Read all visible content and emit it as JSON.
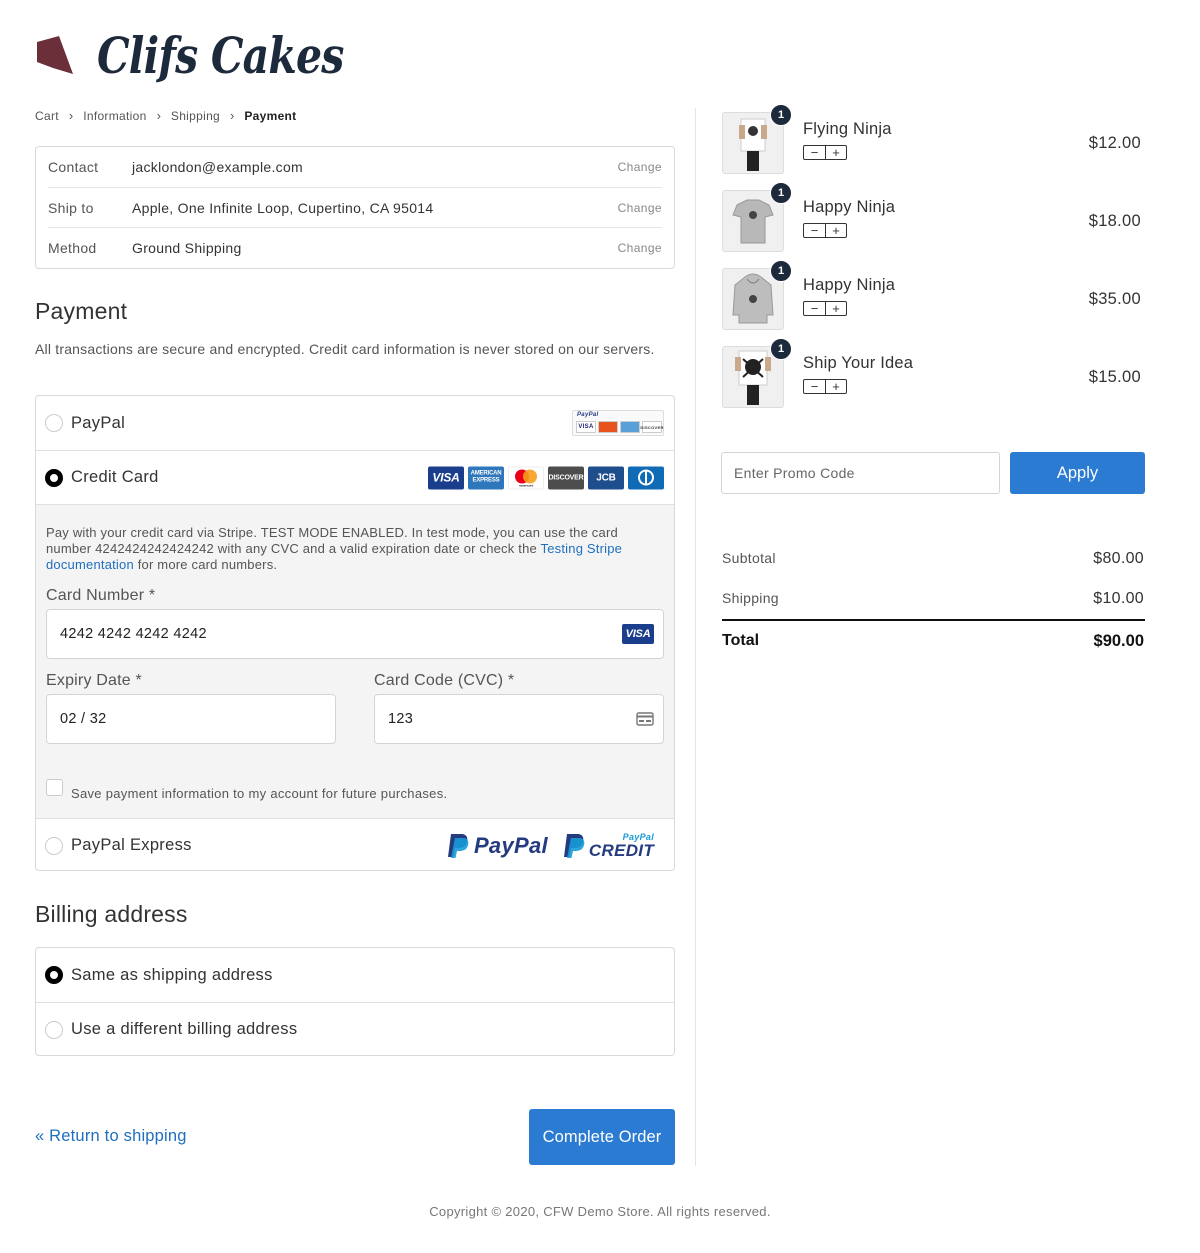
{
  "store": {
    "name": "Clifs Cakes",
    "logo_color": "#6b2f3a"
  },
  "breadcrumb": [
    {
      "label": "Cart",
      "current": false
    },
    {
      "label": "Information",
      "current": false
    },
    {
      "label": "Shipping",
      "current": false
    },
    {
      "label": "Payment",
      "current": true
    }
  ],
  "review": {
    "contact": {
      "label": "Contact",
      "value": "jacklondon@example.com",
      "change": "Change"
    },
    "ship_to": {
      "label": "Ship to",
      "value": "Apple, One Infinite Loop, Cupertino, CA 95014",
      "change": "Change"
    },
    "method": {
      "label": "Method",
      "value": "Ground Shipping",
      "change": "Change"
    }
  },
  "payment": {
    "heading": "Payment",
    "description": "All transactions are secure and encrypted. Credit card information is never stored on our servers.",
    "options": {
      "paypal": {
        "label": "PayPal",
        "selected": false
      },
      "credit_card": {
        "label": "Credit Card",
        "selected": true
      },
      "paypal_express": {
        "label": "PayPal Express",
        "selected": false
      }
    },
    "card_brands": [
      "VISA",
      "AMERICAN EXPRESS",
      "mastercard",
      "DISCOVER",
      "JCB",
      "Diners Club"
    ],
    "paypal_mini": {
      "top": "PayPal",
      "brands": [
        "VISA",
        "",
        "",
        "DISCOVER"
      ]
    },
    "paypal_express_logos": {
      "paypal": "PayPal",
      "credit_small": "PayPal",
      "credit": "CREDIT"
    },
    "stripe_info": {
      "text_before": "Pay with your credit card via Stripe. TEST MODE ENABLED. In test mode, you can use the card number 4242424242424242 with any CVC and a valid expiration date or check the ",
      "link": "Testing Stripe documentation",
      "text_after": " for more card numbers."
    },
    "card_number": {
      "label": "Card Number *",
      "value": "4242 4242 4242 4242",
      "brand": "VISA"
    },
    "expiry": {
      "label": "Expiry Date *",
      "value": "02 / 32"
    },
    "cvc": {
      "label": "Card Code (CVC) *",
      "value": "123"
    },
    "save_info": {
      "label": "Save payment information to my account for future purchases.",
      "checked": false
    }
  },
  "billing": {
    "heading": "Billing address",
    "same": {
      "label": "Same as shipping address",
      "selected": true
    },
    "different": {
      "label": "Use a different billing address",
      "selected": false
    }
  },
  "actions": {
    "return": "« Return to shipping",
    "complete": "Complete Order"
  },
  "cart": {
    "items": [
      {
        "name": "Flying Ninja",
        "qty": "1",
        "price": "$12.00",
        "thumb": "poster-icon"
      },
      {
        "name": "Happy Ninja",
        "qty": "1",
        "price": "$18.00",
        "thumb": "tshirt-icon"
      },
      {
        "name": "Happy Ninja",
        "qty": "1",
        "price": "$35.00",
        "thumb": "hoodie-icon"
      },
      {
        "name": "Ship Your Idea",
        "qty": "1",
        "price": "$15.00",
        "thumb": "poster-icon"
      }
    ],
    "stepper": {
      "minus": "−",
      "plus": "+"
    }
  },
  "promo": {
    "placeholder": "Enter Promo Code",
    "button": "Apply"
  },
  "totals": {
    "subtotal": {
      "label": "Subtotal",
      "value": "$80.00"
    },
    "shipping": {
      "label": "Shipping",
      "value": "$10.00"
    },
    "total": {
      "label": "Total",
      "value": "$90.00"
    }
  },
  "footer": "Copyright © 2020, CFW Demo Store. All rights reserved.",
  "colors": {
    "accent": "#2a7bd1",
    "link": "#1f6fbf",
    "badge": "#1c2a3c"
  }
}
